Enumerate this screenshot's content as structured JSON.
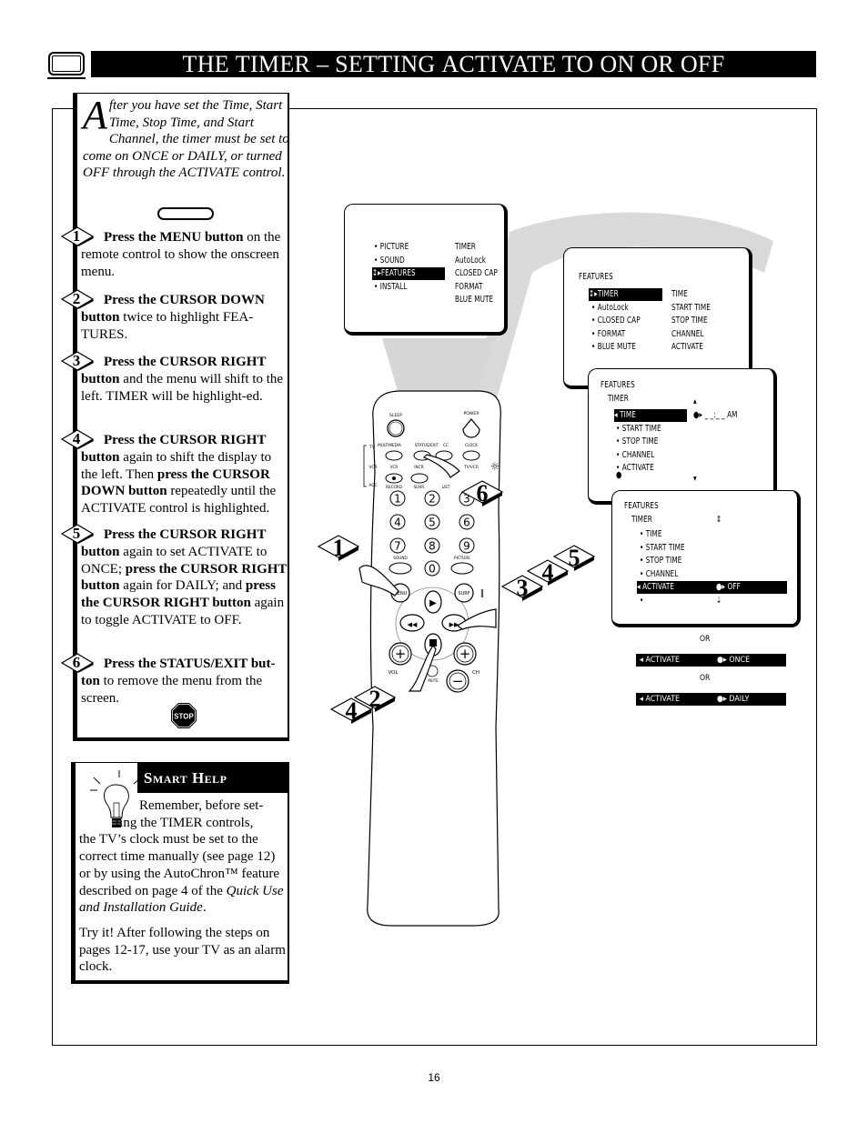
{
  "header": {
    "title_parts": [
      {
        "text": "T",
        "cls": ""
      },
      {
        "text": "HE ",
        "cls": "sc"
      },
      {
        "text": "T",
        "cls": ""
      },
      {
        "text": "IMER",
        "cls": "sc"
      },
      {
        "text": " – ",
        "cls": ""
      },
      {
        "text": "S",
        "cls": ""
      },
      {
        "text": "ETTING ",
        "cls": "sc"
      },
      {
        "text": "A",
        "cls": ""
      },
      {
        "text": "CTIVATE TO ",
        "cls": "sc"
      },
      {
        "text": "ON ",
        "cls": ""
      },
      {
        "text": "OR ",
        "cls": "sc"
      },
      {
        "text": "OFF",
        "cls": ""
      }
    ],
    "title": "The Timer – Setting Activate to ON or OFF"
  },
  "intro": {
    "dropcap": "A",
    "text": "fter you have set the Time, Start Time, Stop Time, and Start Channel, the timer must be set to come on ONCE or DAILY,  or turned OFF through the ACTIVATE control."
  },
  "steps": [
    {
      "num": "1",
      "parts": [
        {
          "b": true,
          "t": "Press the MENU button"
        },
        {
          "b": false,
          "t": " on the remote control to show the onscreen menu."
        }
      ]
    },
    {
      "num": "2",
      "parts": [
        {
          "b": true,
          "t": "Press the CURSOR DOWN button"
        },
        {
          "b": false,
          "t": " twice to highlight FEA-TURES."
        }
      ]
    },
    {
      "num": "3",
      "parts": [
        {
          "b": true,
          "t": "Press the CURSOR RIGHT button"
        },
        {
          "b": false,
          "t": " and the menu will shift to the left. TIMER will be highlight-ed."
        }
      ]
    },
    {
      "num": "4",
      "parts": [
        {
          "b": true,
          "t": "Press the CURSOR RIGHT button"
        },
        {
          "b": false,
          "t": " again to shift the display to the left. Then "
        },
        {
          "b": true,
          "t": "press the CURSOR DOWN button"
        },
        {
          "b": false,
          "t": " repeatedly until the ACTIVATE control is highlighted."
        }
      ]
    },
    {
      "num": "5",
      "parts": [
        {
          "b": true,
          "t": "Press the CURSOR RIGHT button"
        },
        {
          "b": false,
          "t": " again to set ACTIVATE to ONCE; "
        },
        {
          "b": true,
          "t": "press the CURSOR RIGHT button"
        },
        {
          "b": false,
          "t": " again for DAILY; and "
        },
        {
          "b": true,
          "t": "press the CURSOR RIGHT button"
        },
        {
          "b": false,
          "t": " again to toggle ACTIVATE to OFF."
        }
      ]
    },
    {
      "num": "6",
      "parts": [
        {
          "b": true,
          "t": "Press the STATUS/EXIT but-ton"
        },
        {
          "b": false,
          "t": " to remove the menu from the screen."
        }
      ]
    }
  ],
  "stop_sign": {
    "label": "STOP",
    "icon": "stop-sign-icon"
  },
  "smart_help": {
    "title": "Smart Help",
    "line1": "Remember, before set-",
    "line2": "ting the TIMER controls,",
    "rest": "the TV’s clock must be set to the correct time manually (see page 12) or by using the AutoChron™ feature described on page 4 of the ",
    "italic": "Quick Use and Installation Guide",
    "end": ".",
    "tip": "Try it! After following the steps on pages 12-17, use your TV as an alarm clock."
  },
  "osd_main": {
    "left": [
      "PICTURE",
      "SOUND",
      "FEATURES",
      "INSTALL"
    ],
    "selected_index": 2,
    "right": [
      "TIMER",
      "AutoLock",
      "CLOSED CAP",
      "FORMAT",
      "BLUE MUTE"
    ]
  },
  "osd_features": {
    "heading": "FEATURES",
    "left": [
      "TIMER",
      "AutoLock",
      "CLOSED CAP",
      "FORMAT",
      "BLUE MUTE"
    ],
    "selected_index": 0,
    "right": [
      "TIME",
      "START TIME",
      "STOP TIME",
      "CHANNEL",
      "ACTIVATE"
    ]
  },
  "osd_timer": {
    "heading": "FEATURES",
    "sub": "TIMER",
    "items": [
      "TIME",
      "START TIME",
      "STOP TIME",
      "CHANNEL",
      "ACTIVATE"
    ],
    "selected_index": 0,
    "value": "_ _:_ _ AM"
  },
  "osd_activate": {
    "heading": "FEATURES",
    "sub": "TIMER",
    "items": [
      "TIME",
      "START TIME",
      "STOP TIME",
      "CHANNEL",
      "ACTIVATE"
    ],
    "selected_index": 4,
    "value": "OFF"
  },
  "alternatives": [
    {
      "or": "OR",
      "label": "ACTIVATE",
      "value": "ONCE"
    },
    {
      "or": "OR",
      "label": "ACTIVATE",
      "value": "DAILY"
    }
  ],
  "remote": {
    "labels": {
      "sleep": "SLEEP",
      "power": "POWER",
      "tv": "TV",
      "vcr_mode": "VCR",
      "acc": "ACC",
      "multimedia": "MULTIMEDIA",
      "status_exit": "STATUS/EXIT",
      "cc": "CC",
      "clock": "CLOCK",
      "vcr": "VCR",
      "incr": "INCR.",
      "tvvcr": "TV/VCR",
      "record": "RECORD",
      "surr": "SURR.",
      "list": "LIST",
      "sound": "SOUND",
      "picture": "PICTURE",
      "menu": "MENU",
      "surf": "SURF",
      "vol": "VOL",
      "ch": "CH",
      "mute": "MUTE"
    },
    "digits": [
      "1",
      "2",
      "3",
      "4",
      "5",
      "6",
      "7",
      "8",
      "9",
      "0"
    ],
    "callouts": [
      "1",
      "2",
      "3",
      "4",
      "4",
      "5",
      "6"
    ]
  },
  "page_number": "16"
}
